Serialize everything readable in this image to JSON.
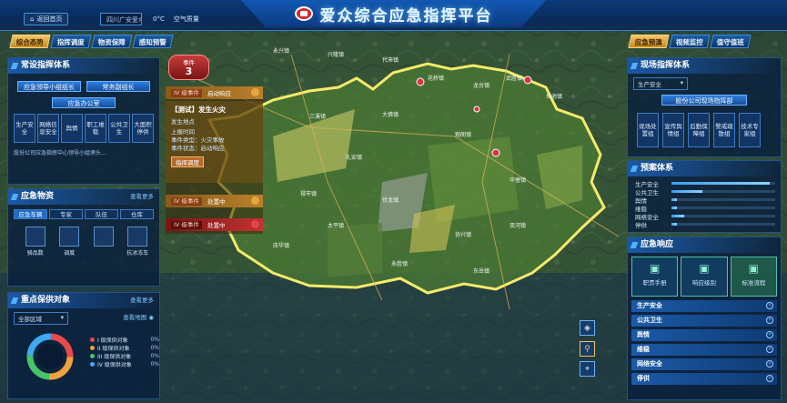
{
  "header": {
    "title": "爱众综合应急指挥平台",
    "back_label": "返回首页",
    "region": "四川广安爱众股...",
    "temperature": "0°C",
    "air_quality": "空气质量"
  },
  "left_tabs": [
    "综合态势",
    "指挥调度",
    "物资保障",
    "感知预警"
  ],
  "left_tabs_active": 0,
  "right_tabs": [
    "应急预演",
    "视频监控",
    "值守值班"
  ],
  "right_tabs_active": 0,
  "command_panel": {
    "title": "常设指挥体系",
    "leader": "应急领导小组组长",
    "deputy": "常务副组长",
    "office": "应急办公室",
    "groups": [
      "生产安全",
      "网络信息安全",
      "舆情",
      "职工维稳",
      "公共卫生",
      "大面积停供"
    ],
    "desc": "股份公司应急指挥中心领导小组承头..."
  },
  "supplies_panel": {
    "title": "应急物资",
    "more": "查看更多",
    "tabs": [
      "应急车辆",
      "专家",
      "队伍",
      "仓库"
    ],
    "items": [
      {
        "label": "骑品数",
        "icon": "vehicle-icon"
      },
      {
        "label": "调度",
        "icon": "dispatch-icon"
      },
      {
        "label": "",
        "icon": "person-icon"
      },
      {
        "label": "抗冰冻车",
        "icon": "vehicle-icon"
      }
    ]
  },
  "protect_panel": {
    "title": "重点保供对象",
    "more": "查看更多",
    "region_select": "全部区域",
    "map_link": "查看地图",
    "levels": [
      {
        "label": "I 级保供对象",
        "color": "#e84a4a",
        "value": "0%"
      },
      {
        "label": "II 级保供对象",
        "color": "#f0a23c",
        "value": "0%"
      },
      {
        "label": "III 级保供对象",
        "color": "#46c46a",
        "value": "0%"
      },
      {
        "label": "IV 级保供对象",
        "color": "#3fa8f5",
        "value": "0%"
      }
    ]
  },
  "events": {
    "badge_label": "事件",
    "badge_count": "3",
    "cards": [
      {
        "tag": "IV 级事件",
        "status": "启动响应",
        "color": "#e6a83c"
      },
      {
        "tag": "IV 级事件",
        "status": "处置中",
        "color": "#e6a83c"
      },
      {
        "tag": "IV 级事件",
        "status": "处置中",
        "color": "#e14646"
      }
    ],
    "detail": {
      "title": "【测试】发生火灾",
      "location_label": "发生地点",
      "time_label": "上报时间",
      "type_label": "事件类型",
      "type_value": "火灾事故",
      "state_label": "事件状态",
      "state_value": "启动响应",
      "action": "指挥调度"
    }
  },
  "live_panel": {
    "title": "现场指挥体系",
    "select": "生产安全",
    "head": "股份公司现场指挥部",
    "groups": [
      "现场处置组",
      "宣传舆情组",
      "后勤保障组",
      "警戒疏散组",
      "技术专家组"
    ]
  },
  "plan_panel": {
    "title": "预案体系",
    "rows": [
      {
        "label": "生产安全",
        "value": 0.95
      },
      {
        "label": "公共卫生",
        "value": 0.3
      },
      {
        "label": "舆情",
        "value": 0.05
      },
      {
        "label": "维稳",
        "value": 0.05
      },
      {
        "label": "网络安全",
        "value": 0.12
      },
      {
        "label": "停供",
        "value": 0.05
      }
    ]
  },
  "response_panel": {
    "title": "应急响应",
    "cards": [
      {
        "label": "职责手册",
        "icon": "manual-icon"
      },
      {
        "label": "响应级别",
        "icon": "level-icon"
      },
      {
        "label": "标准流程",
        "icon": "flow-icon"
      }
    ],
    "list": [
      "生产安全",
      "公共卫生",
      "舆情",
      "维稳",
      "网络安全",
      "停供"
    ]
  },
  "map": {
    "towns": [
      "永兴镇",
      "兴隆镇",
      "代市镇",
      "花桥镇",
      "龙台镇",
      "武胜镇",
      "岳池镇",
      "三溪镇",
      "大佛镇",
      "观阁镇",
      "礼安镇",
      "华蓥镇",
      "禄市镇",
      "伏龙镇",
      "太平镇",
      "协兴镇",
      "双河镇",
      "庆华镇",
      "永胜镇",
      "东岳镇"
    ]
  },
  "colors": {
    "accent": "#f0c060",
    "brand_blue": "#1259b4",
    "boundary": "#f5ea6a"
  }
}
